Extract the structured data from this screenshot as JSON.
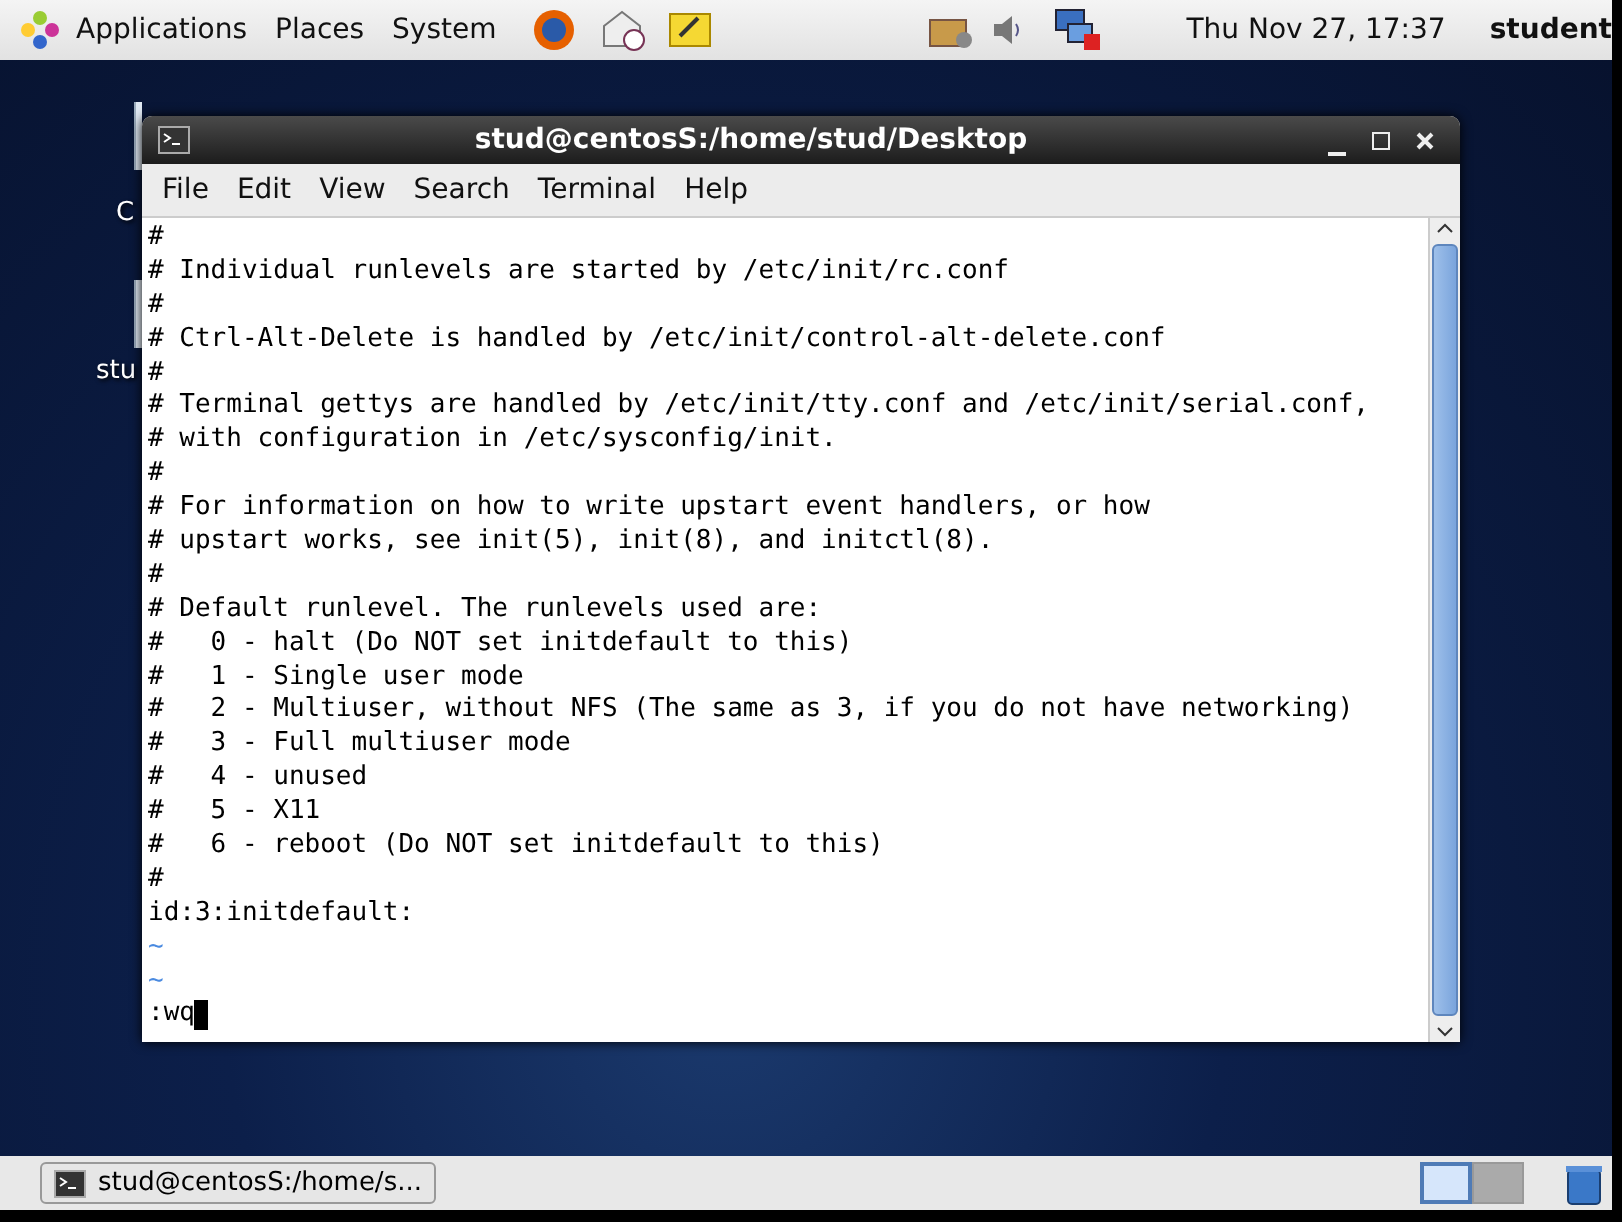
{
  "top_panel": {
    "menus": [
      "Applications",
      "Places",
      "System"
    ],
    "clock": "Thu Nov 27, 17:37",
    "user": "student"
  },
  "desktop_icons": [
    {
      "label": "C"
    },
    {
      "label": "stu"
    }
  ],
  "window": {
    "title": "stud@centosS:/home/stud/Desktop",
    "menu": [
      "File",
      "Edit",
      "View",
      "Search",
      "Terminal",
      "Help"
    ],
    "lines": [
      {
        "kind": "text",
        "text": "#"
      },
      {
        "kind": "text",
        "text": "# Individual runlevels are started by /etc/init/rc.conf"
      },
      {
        "kind": "text",
        "text": "#"
      },
      {
        "kind": "text",
        "text": "# Ctrl-Alt-Delete is handled by /etc/init/control-alt-delete.conf"
      },
      {
        "kind": "text",
        "text": "#"
      },
      {
        "kind": "text",
        "text": "# Terminal gettys are handled by /etc/init/tty.conf and /etc/init/serial.conf,"
      },
      {
        "kind": "text",
        "text": "# with configuration in /etc/sysconfig/init."
      },
      {
        "kind": "text",
        "text": "#"
      },
      {
        "kind": "text",
        "text": "# For information on how to write upstart event handlers, or how"
      },
      {
        "kind": "text",
        "text": "# upstart works, see init(5), init(8), and initctl(8)."
      },
      {
        "kind": "text",
        "text": "#"
      },
      {
        "kind": "text",
        "text": "# Default runlevel. The runlevels used are:"
      },
      {
        "kind": "text",
        "text": "#   0 - halt (Do NOT set initdefault to this)"
      },
      {
        "kind": "text",
        "text": "#   1 - Single user mode"
      },
      {
        "kind": "text",
        "text": "#   2 - Multiuser, without NFS (The same as 3, if you do not have networking)"
      },
      {
        "kind": "text",
        "text": "#   3 - Full multiuser mode"
      },
      {
        "kind": "text",
        "text": "#   4 - unused"
      },
      {
        "kind": "text",
        "text": "#   5 - X11"
      },
      {
        "kind": "text",
        "text": "#   6 - reboot (Do NOT set initdefault to this)"
      },
      {
        "kind": "text",
        "text": "#"
      },
      {
        "kind": "text",
        "text": "id:3:initdefault:"
      },
      {
        "kind": "tilde",
        "text": "~"
      },
      {
        "kind": "tilde",
        "text": "~"
      },
      {
        "kind": "command",
        "text": ":wq"
      }
    ]
  },
  "taskbar": {
    "items": [
      {
        "label": "stud@centosS:/home/s...",
        "selected": false
      }
    ],
    "workspaces": [
      {
        "selected": true
      },
      {
        "selected": false
      }
    ]
  }
}
